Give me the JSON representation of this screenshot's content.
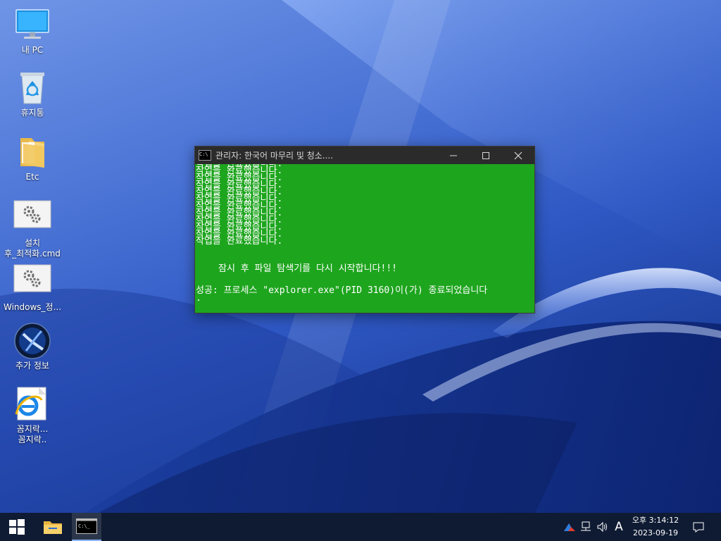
{
  "desktop": {
    "icons": [
      {
        "label": "내 PC",
        "icon": "monitor-icon"
      },
      {
        "label": "휴지통",
        "icon": "recycle-bin-icon"
      },
      {
        "label": "Etc",
        "icon": "folder-icon"
      },
      {
        "label_line1": "설치",
        "label_line2": "후_최적화.cmd",
        "icon": "cmd-settings-icon"
      },
      {
        "label": "Windows_정...",
        "icon": "cmd-settings-icon"
      },
      {
        "label": "추가 정보",
        "icon": "info-orb-icon"
      },
      {
        "label_line1": "꼼지락...",
        "label_line2": "꼼지락..",
        "icon": "internet-explorer-icon"
      }
    ]
  },
  "cmd_window": {
    "title": "관리자:   한국어 마무리 및 청소....",
    "minimize_symbol": "—",
    "maximize_symbol": "☐",
    "close_symbol": "✕",
    "background": "#1ea51e",
    "done_lines": [
      "작업을 완료했습니다.",
      "작업을 완료했습니다.",
      "작업을 완료했습니다.",
      "작업을 완료했습니다.",
      "작업을 완료했습니다.",
      "작업을 완료했습니다.",
      "작업을 완료했습니다.",
      "작업을 완료했습니다.",
      "작업을 완료했습니다.",
      "작업을 완료했습니다.",
      "작업을 완료했습니다.",
      "작업을 완료했습니다."
    ],
    "restart_message": "잠시 후 파일 탐색기를 다시 시작합니다!!!",
    "success_message": "성공: 프로세스 \"explorer.exe\"(PID 3160)이(가) 종료되었습니다",
    "continuation": "."
  },
  "taskbar": {
    "clock_time": "오후 3:14:12",
    "clock_date": "2023-09-19",
    "ime_indicator": "A",
    "cmd_icon_text": "C:\\_"
  }
}
